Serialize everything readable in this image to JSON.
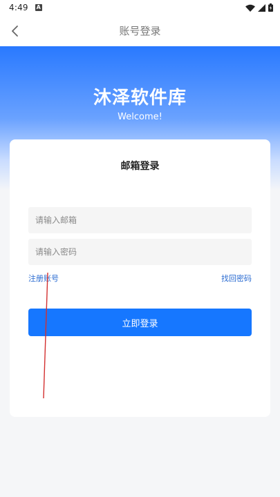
{
  "status_bar": {
    "time": "4:49",
    "notification_icon": "a-letter-icon",
    "icons": [
      "wifi-icon",
      "signal-icon",
      "battery-icon"
    ]
  },
  "nav": {
    "title": "账号登录",
    "back_icon": "chevron-left-icon"
  },
  "hero": {
    "app_name": "沐泽软件库",
    "welcome": "Welcome!"
  },
  "login_card": {
    "title": "邮箱登录",
    "email_placeholder": "请输入邮箱",
    "password_placeholder": "请输入密码",
    "register_label": "注册账号",
    "forgot_label": "找回密码",
    "login_button_label": "立即登录"
  },
  "colors": {
    "primary": "#1677ff",
    "link": "#2a6bd1",
    "hero_top": "#2979ff",
    "annotation": "#d32f2f"
  }
}
